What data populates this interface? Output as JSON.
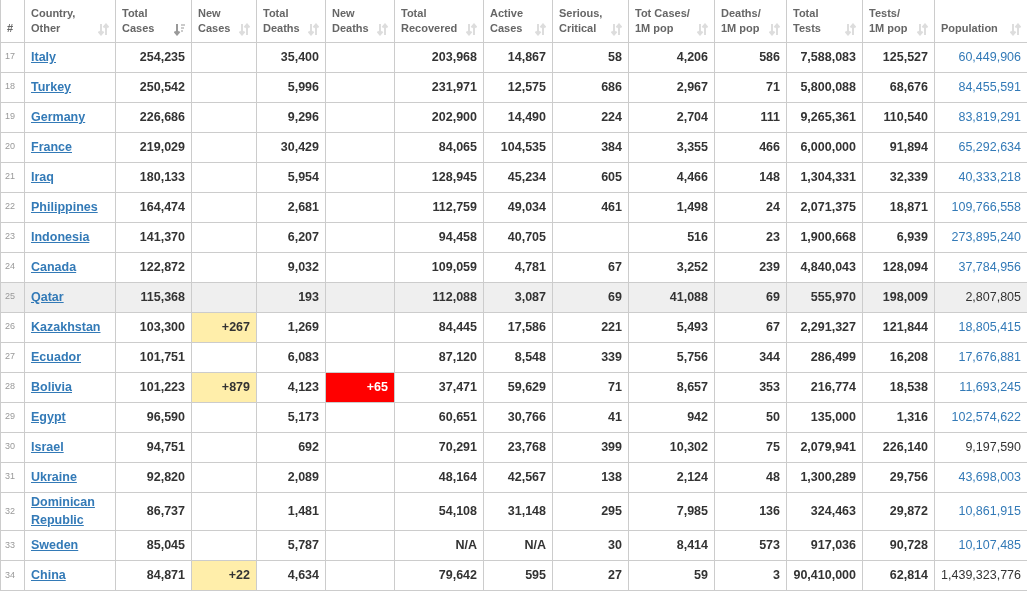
{
  "columns": [
    {
      "label": "#",
      "kind": "index"
    },
    {
      "label": "Country, Other",
      "sorted": false,
      "kind": "country"
    },
    {
      "label": "Total Cases",
      "sorted": true,
      "kind": "number"
    },
    {
      "label": "New Cases",
      "sorted": false,
      "kind": "new_cases"
    },
    {
      "label": "Total Deaths",
      "sorted": false,
      "kind": "number"
    },
    {
      "label": "New Deaths",
      "sorted": false,
      "kind": "new_deaths"
    },
    {
      "label": "Total Recovered",
      "sorted": false,
      "kind": "number"
    },
    {
      "label": "Active Cases",
      "sorted": false,
      "kind": "number"
    },
    {
      "label": "Serious, Critical",
      "sorted": false,
      "kind": "number"
    },
    {
      "label": "Tot Cases/ 1M pop",
      "sorted": false,
      "kind": "number"
    },
    {
      "label": "Deaths/ 1M pop",
      "sorted": false,
      "kind": "number"
    },
    {
      "label": "Total Tests",
      "sorted": false,
      "kind": "number"
    },
    {
      "label": "Tests/ 1M pop",
      "sorted": false,
      "kind": "number"
    },
    {
      "label": "Population",
      "sorted": false,
      "kind": "population"
    }
  ],
  "rows": [
    {
      "selected": false,
      "population_linked": true,
      "cells": [
        "17",
        "Italy",
        "254,235",
        null,
        "35,400",
        null,
        "203,968",
        "14,867",
        "58",
        "4,206",
        "586",
        "7,588,083",
        "125,527",
        "60,449,906"
      ]
    },
    {
      "selected": false,
      "population_linked": true,
      "cells": [
        "18",
        "Turkey",
        "250,542",
        null,
        "5,996",
        null,
        "231,971",
        "12,575",
        "686",
        "2,967",
        "71",
        "5,800,088",
        "68,676",
        "84,455,591"
      ]
    },
    {
      "selected": false,
      "population_linked": true,
      "cells": [
        "19",
        "Germany",
        "226,686",
        null,
        "9,296",
        null,
        "202,900",
        "14,490",
        "224",
        "2,704",
        "111",
        "9,265,361",
        "110,540",
        "83,819,291"
      ]
    },
    {
      "selected": false,
      "population_linked": true,
      "cells": [
        "20",
        "France",
        "219,029",
        null,
        "30,429",
        null,
        "84,065",
        "104,535",
        "384",
        "3,355",
        "466",
        "6,000,000",
        "91,894",
        "65,292,634"
      ]
    },
    {
      "selected": false,
      "population_linked": true,
      "cells": [
        "21",
        "Iraq",
        "180,133",
        null,
        "5,954",
        null,
        "128,945",
        "45,234",
        "605",
        "4,466",
        "148",
        "1,304,331",
        "32,339",
        "40,333,218"
      ]
    },
    {
      "selected": false,
      "population_linked": true,
      "cells": [
        "22",
        "Philippines",
        "164,474",
        null,
        "2,681",
        null,
        "112,759",
        "49,034",
        "461",
        "1,498",
        "24",
        "2,071,375",
        "18,871",
        "109,766,558"
      ]
    },
    {
      "selected": false,
      "population_linked": true,
      "cells": [
        "23",
        "Indonesia",
        "141,370",
        null,
        "6,207",
        null,
        "94,458",
        "40,705",
        null,
        "516",
        "23",
        "1,900,668",
        "6,939",
        "273,895,240"
      ]
    },
    {
      "selected": false,
      "population_linked": true,
      "cells": [
        "24",
        "Canada",
        "122,872",
        null,
        "9,032",
        null,
        "109,059",
        "4,781",
        "67",
        "3,252",
        "239",
        "4,840,043",
        "128,094",
        "37,784,956"
      ]
    },
    {
      "selected": true,
      "population_linked": false,
      "cells": [
        "25",
        "Qatar",
        "115,368",
        null,
        "193",
        null,
        "112,088",
        "3,087",
        "69",
        "41,088",
        "69",
        "555,970",
        "198,009",
        "2,807,805"
      ]
    },
    {
      "selected": false,
      "population_linked": true,
      "cells": [
        "26",
        "Kazakhstan",
        "103,300",
        "+267",
        "1,269",
        null,
        "84,445",
        "17,586",
        "221",
        "5,493",
        "67",
        "2,291,327",
        "121,844",
        "18,805,415"
      ]
    },
    {
      "selected": false,
      "population_linked": true,
      "cells": [
        "27",
        "Ecuador",
        "101,751",
        null,
        "6,083",
        null,
        "87,120",
        "8,548",
        "339",
        "5,756",
        "344",
        "286,499",
        "16,208",
        "17,676,881"
      ]
    },
    {
      "selected": false,
      "population_linked": true,
      "cells": [
        "28",
        "Bolivia",
        "101,223",
        "+879",
        "4,123",
        "+65",
        "37,471",
        "59,629",
        "71",
        "8,657",
        "353",
        "216,774",
        "18,538",
        "11,693,245"
      ]
    },
    {
      "selected": false,
      "population_linked": true,
      "cells": [
        "29",
        "Egypt",
        "96,590",
        null,
        "5,173",
        null,
        "60,651",
        "30,766",
        "41",
        "942",
        "50",
        "135,000",
        "1,316",
        "102,574,622"
      ]
    },
    {
      "selected": false,
      "population_linked": false,
      "cells": [
        "30",
        "Israel",
        "94,751",
        null,
        "692",
        null,
        "70,291",
        "23,768",
        "399",
        "10,302",
        "75",
        "2,079,941",
        "226,140",
        "9,197,590"
      ]
    },
    {
      "selected": false,
      "population_linked": true,
      "cells": [
        "31",
        "Ukraine",
        "92,820",
        null,
        "2,089",
        null,
        "48,164",
        "42,567",
        "138",
        "2,124",
        "48",
        "1,300,289",
        "29,756",
        "43,698,003"
      ]
    },
    {
      "selected": false,
      "population_linked": true,
      "cells": [
        "32",
        "Dominican Republic",
        "86,737",
        null,
        "1,481",
        null,
        "54,108",
        "31,148",
        "295",
        "7,985",
        "136",
        "324,463",
        "29,872",
        "10,861,915"
      ]
    },
    {
      "selected": false,
      "population_linked": true,
      "cells": [
        "33",
        "Sweden",
        "85,045",
        null,
        "5,787",
        null,
        "N/A",
        "N/A",
        "30",
        "8,414",
        "573",
        "917,036",
        "90,728",
        "10,107,485"
      ]
    },
    {
      "selected": false,
      "population_linked": false,
      "cells": [
        "34",
        "China",
        "84,871",
        "+22",
        "4,634",
        null,
        "79,642",
        "595",
        "27",
        "59",
        "3",
        "90,410,000",
        "62,814",
        "1,439,323,776"
      ]
    }
  ]
}
